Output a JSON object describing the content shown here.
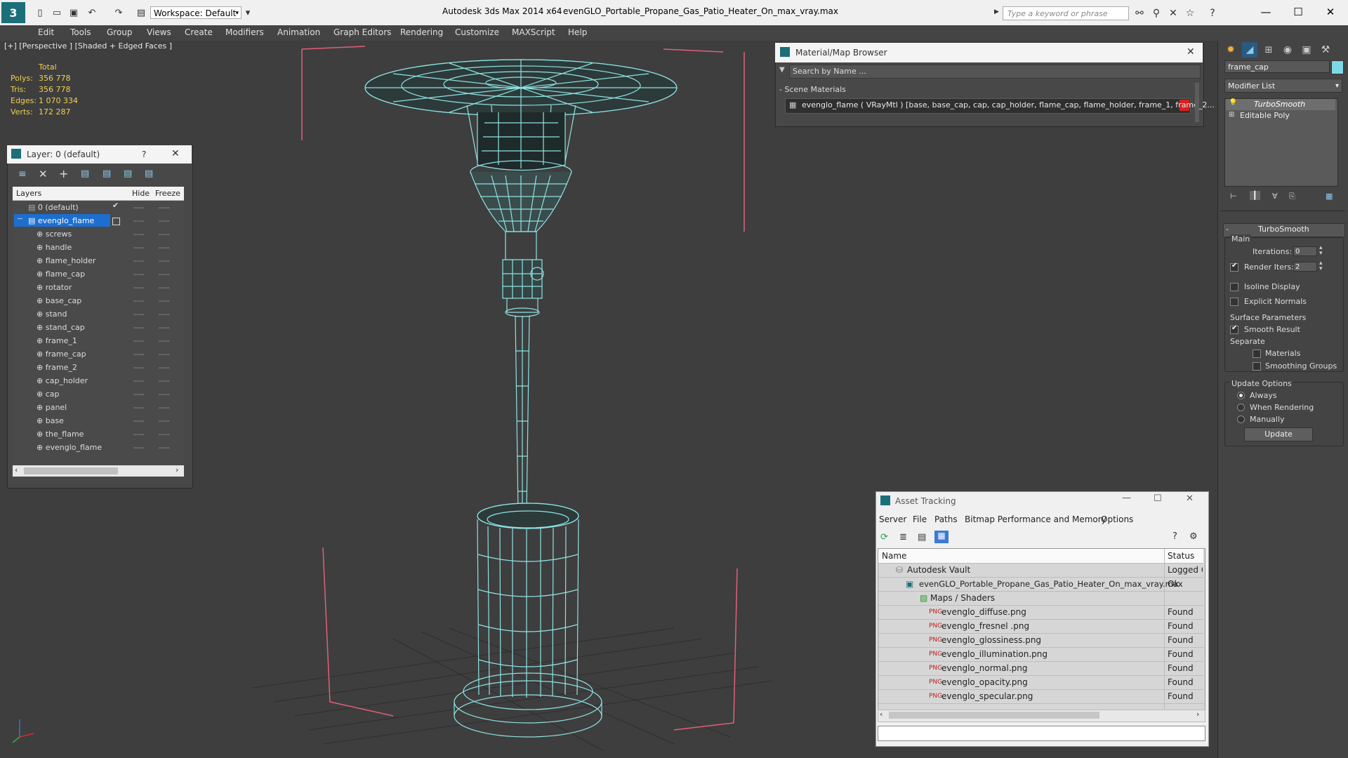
{
  "titlebar": {
    "workspace": "Workspace: Default",
    "app_title": "Autodesk 3ds Max  2014 x64",
    "file_title": "evenGLO_Portable_Propane_Gas_Patio_Heater_On_max_vray.max",
    "search_placeholder": "Type a keyword or phrase"
  },
  "menu": [
    "Edit",
    "Tools",
    "Group",
    "Views",
    "Create",
    "Modifiers",
    "Animation",
    "Graph Editors",
    "Rendering",
    "Customize",
    "MAXScript",
    "Help"
  ],
  "viewport": {
    "label": "[+] [Perspective ] [Shaded + Edged Faces ]",
    "stats_header": "Total",
    "stats": [
      {
        "label": "Polys:",
        "value": "356 778"
      },
      {
        "label": "Tris:",
        "value": "356 778"
      },
      {
        "label": "Edges:",
        "value": "1 070 334"
      },
      {
        "label": "Verts:",
        "value": "172 287"
      }
    ]
  },
  "layer_panel": {
    "title": "Layer: 0 (default)",
    "help": "?",
    "col_layers": "Layers",
    "col_hide": "Hide",
    "col_freeze": "Freeze",
    "rows": [
      "0 (default)",
      "evenglo_flame",
      "screws",
      "handle",
      "flame_holder",
      "flame_cap",
      "rotator",
      "base_cap",
      "stand",
      "stand_cap",
      "frame_1",
      "frame_cap",
      "frame_2",
      "cap_holder",
      "cap",
      "panel",
      "base",
      "the_flame",
      "evenglo_flame"
    ],
    "dash": "----"
  },
  "material_browser": {
    "title": "Material/Map Browser",
    "search": "Search by Name ...",
    "section": "- Scene Materials",
    "item": "evenglo_flame  ( VRayMtl )  [base, base_cap, cap, cap_holder, flame_cap, flame_holder, frame_1, frame_2..."
  },
  "command_panel": {
    "object_name": "frame_cap",
    "modifier_list": "Modifier List",
    "stack": [
      "TurboSmooth",
      "Editable Poly"
    ],
    "rollout": "TurboSmooth",
    "main": "Main",
    "iterations_label": "Iterations:",
    "iterations": "0",
    "render_iters_label": "Render Iters:",
    "render_iters": "2",
    "isoline": "Isoline Display",
    "explicit": "Explicit Normals",
    "surface": "Surface Parameters",
    "smooth": "Smooth Result",
    "separate": "Separate",
    "materials": "Materials",
    "smoothing_groups": "Smoothing Groups",
    "update_options": "Update Options",
    "always": "Always",
    "when_rendering": "When Rendering",
    "manually": "Manually",
    "update": "Update"
  },
  "asset_tracking": {
    "title": "Asset Tracking",
    "menu": [
      "Server",
      "File",
      "Paths",
      "Bitmap Performance and Memory",
      "Options"
    ],
    "col_name": "Name",
    "col_status": "Status",
    "rows": [
      {
        "name": "Autodesk Vault",
        "status": "Logged O"
      },
      {
        "name": "evenGLO_Portable_Propane_Gas_Patio_Heater_On_max_vray.max",
        "status": "Ok"
      },
      {
        "name": "Maps / Shaders",
        "status": ""
      },
      {
        "name": "evenglo_diffuse.png",
        "status": "Found"
      },
      {
        "name": "evenglo_fresnel .png",
        "status": "Found"
      },
      {
        "name": "evenglo_glossiness.png",
        "status": "Found"
      },
      {
        "name": "evenglo_illumination.png",
        "status": "Found"
      },
      {
        "name": "evenglo_normal.png",
        "status": "Found"
      },
      {
        "name": "evenglo_opacity.png",
        "status": "Found"
      },
      {
        "name": "evenglo_specular.png",
        "status": "Found"
      }
    ]
  },
  "colors": {
    "wire": "#8fe3e3",
    "accent": "#1c6fd0",
    "bound": "#e0607a"
  }
}
